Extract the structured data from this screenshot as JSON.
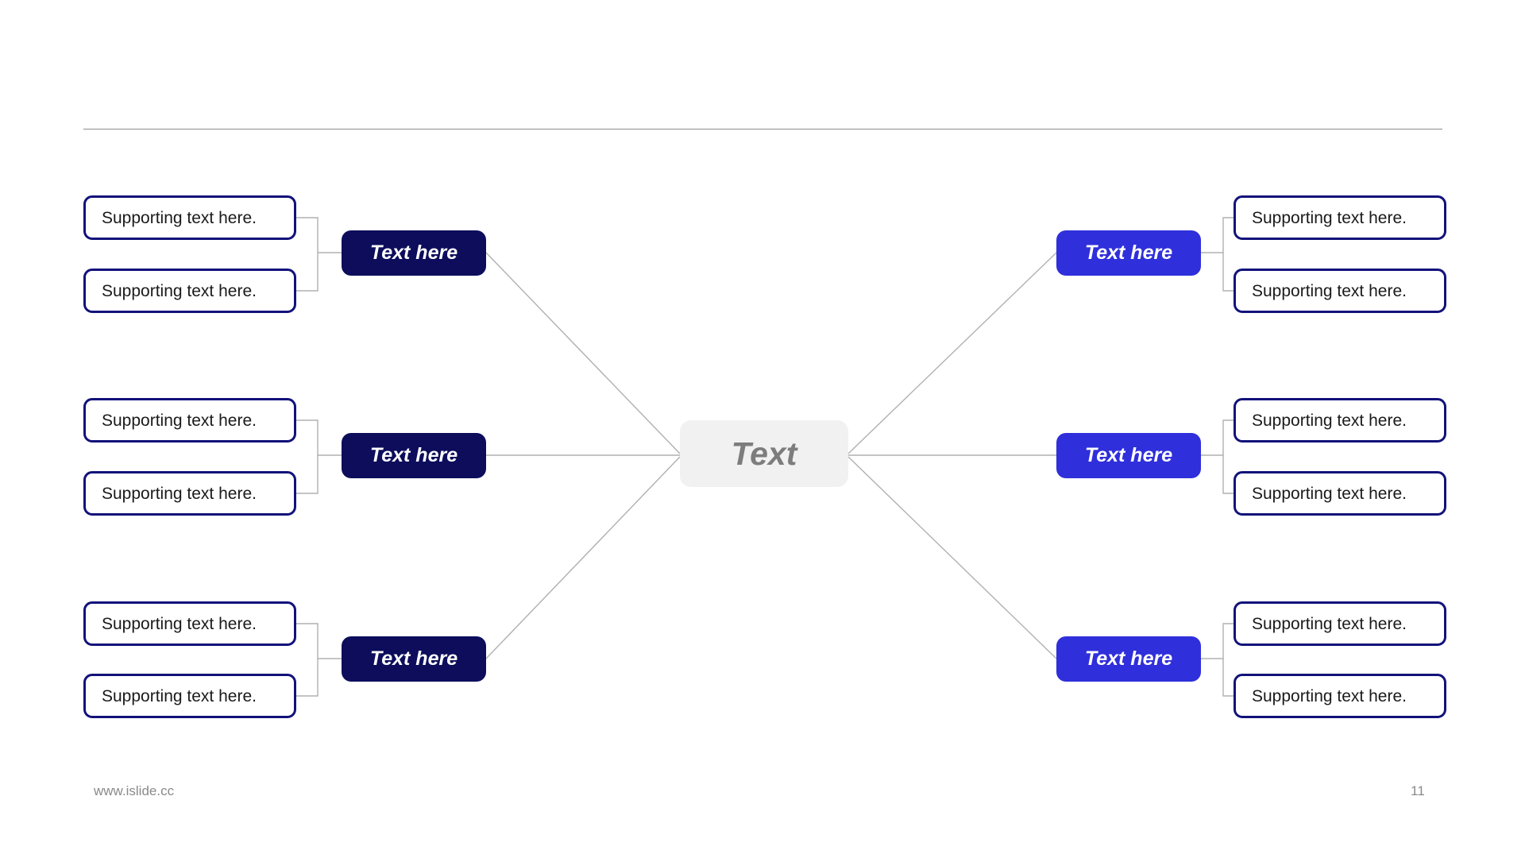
{
  "slide": {
    "page_number": "11",
    "website": "www.islide.cc",
    "colors": {
      "branch_left": "#0d0d5c",
      "branch_right": "#2f2fdb",
      "support_border": "#12127a",
      "center_fill": "#f1f1f1",
      "center_text": "#7d7d7d",
      "connector_line": "#b0b0b0",
      "divider": "#8c8c8c"
    }
  },
  "center": {
    "label": "Text"
  },
  "left_branches": [
    {
      "label": "Text here",
      "supports": [
        {
          "text": "Supporting text here."
        },
        {
          "text": "Supporting text here."
        }
      ]
    },
    {
      "label": "Text here",
      "supports": [
        {
          "text": "Supporting text here."
        },
        {
          "text": "Supporting text here."
        }
      ]
    },
    {
      "label": "Text here",
      "supports": [
        {
          "text": "Supporting text here."
        },
        {
          "text": "Supporting text here."
        }
      ]
    }
  ],
  "right_branches": [
    {
      "label": "Text here",
      "supports": [
        {
          "text": "Supporting text here."
        },
        {
          "text": "Supporting text here."
        }
      ]
    },
    {
      "label": "Text here",
      "supports": [
        {
          "text": "Supporting text here."
        },
        {
          "text": "Supporting text here."
        }
      ]
    },
    {
      "label": "Text here",
      "supports": [
        {
          "text": "Supporting text here."
        },
        {
          "text": "Supporting text here."
        }
      ]
    }
  ]
}
